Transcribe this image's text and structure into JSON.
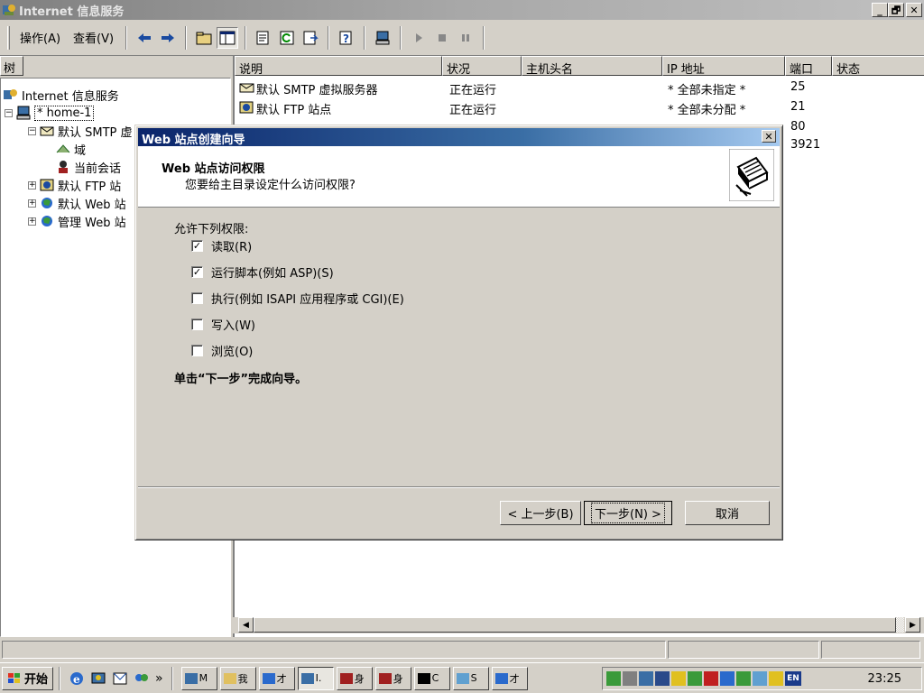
{
  "window": {
    "title": "Internet 信息服务",
    "min_label": "_",
    "max_label": "🗗",
    "close_label": "✕"
  },
  "menu": {
    "items": [
      "操作(A)",
      "查看(V)"
    ]
  },
  "tree": {
    "header": "树",
    "items": [
      {
        "label": "Internet 信息服务",
        "expander": ""
      },
      {
        "label": "* home-1",
        "expander": "−"
      },
      {
        "label": "默认 SMTP 虚",
        "expander": "−"
      },
      {
        "label": "域",
        "expander": ""
      },
      {
        "label": "当前会话",
        "expander": ""
      },
      {
        "label": "默认 FTP 站",
        "expander": "+"
      },
      {
        "label": "默认 Web 站",
        "expander": "+"
      },
      {
        "label": "管理 Web 站",
        "expander": "+"
      }
    ]
  },
  "list": {
    "columns": [
      "说明",
      "状况",
      "主机头名",
      "IP 地址",
      "端口",
      "状态"
    ],
    "rows": [
      {
        "desc": "默认 SMTP 虚拟服务器",
        "status": "正在运行",
        "host": "",
        "ip": "* 全部未指定 *",
        "port": "25"
      },
      {
        "desc": "默认 FTP 站点",
        "status": "正在运行",
        "host": "",
        "ip": "* 全部未分配 *",
        "port": "21"
      },
      {
        "desc": "",
        "status": "",
        "host": "",
        "ip": "",
        "port": "80"
      },
      {
        "desc": "",
        "status": "",
        "host": "",
        "ip": "",
        "port": "3921"
      }
    ]
  },
  "dialog": {
    "title": "Web 站点创建向导",
    "close_label": "✕",
    "header_title": "Web 站点访问权限",
    "header_subtitle": "您要给主目录设定什么访问权限?",
    "perm_heading": "允许下列权限:",
    "permissions": [
      {
        "label": "读取(R)",
        "checked": true
      },
      {
        "label": "运行脚本(例如 ASP)(S)",
        "checked": true
      },
      {
        "label": "执行(例如 ISAPI 应用程序或 CGI)(E)",
        "checked": false
      },
      {
        "label": "写入(W)",
        "checked": false
      },
      {
        "label": "浏览(O)",
        "checked": false
      }
    ],
    "hint": "单击“下一步”完成向导。",
    "buttons": {
      "back": "< 上一步(B)",
      "next": "下一步(N) >",
      "cancel": "取消"
    }
  },
  "taskbar": {
    "start_label": "开始",
    "more_label": "»",
    "tasks": [
      "M",
      "我",
      "才",
      "I.",
      "身",
      "身",
      "C",
      "S",
      "才"
    ],
    "lang": "EN",
    "clock": "23:25"
  },
  "colors": {
    "dialog_title_start": "#0a246a",
    "dialog_title_end": "#a6caf0",
    "window_face": "#d4d0c8"
  }
}
